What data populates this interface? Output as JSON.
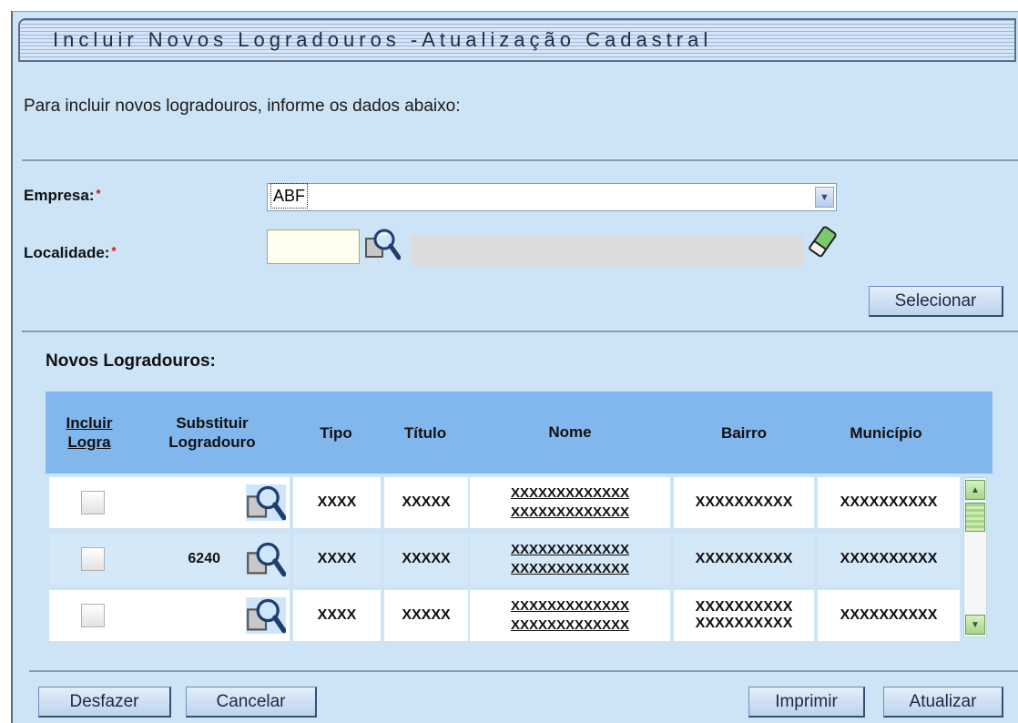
{
  "header": {
    "title": "Incluir Novos Logradouros -Atualização Cadastral"
  },
  "intro_text": "Para incluir novos logradouros, informe os dados abaixo:",
  "form": {
    "empresa_label": "Empresa:",
    "empresa_value": "ABF",
    "localidade_label": "Localidade:",
    "required_marker": "*",
    "localidade_value": "",
    "localidade_description": ""
  },
  "buttons": {
    "selecionar": "Selecionar",
    "desfazer": "Desfazer",
    "cancelar": "Cancelar",
    "imprimir": "Imprimir",
    "atualizar": "Atualizar"
  },
  "section_label": "Novos Logradouros:",
  "table": {
    "headers": {
      "incluir_line1": "Incluir",
      "incluir_line2": "Logra",
      "substituir_line1": "Substituir",
      "substituir_line2": "Logradouro",
      "tipo": "Tipo",
      "titulo": "Título",
      "nome": "Nome",
      "bairro": "Bairro",
      "municipio": "Município"
    },
    "rows": [
      {
        "checked": false,
        "substituir": "",
        "tipo": "XXXX",
        "titulo": "XXXXX",
        "nome_line1": "XXXXXXXXXXXXX",
        "nome_line2": "XXXXXXXXXXXXX",
        "bairro_line1": "XXXXXXXXXX",
        "bairro_line2": "",
        "municipio": "XXXXXXXXXX"
      },
      {
        "checked": false,
        "substituir": "6240",
        "tipo": "XXXX",
        "titulo": "XXXXX",
        "nome_line1": "XXXXXXXXXXXXX",
        "nome_line2": "XXXXXXXXXXXXX",
        "bairro_line1": "XXXXXXXXXX",
        "bairro_line2": "",
        "municipio": "XXXXXXXXXX"
      },
      {
        "checked": false,
        "substituir": "",
        "tipo": "XXXX",
        "titulo": "XXXXX",
        "nome_line1": "XXXXXXXXXXXXX",
        "nome_line2": "XXXXXXXXXXXXX",
        "bairro_line1": "XXXXXXXXXX",
        "bairro_line2": "XXXXXXXXXX",
        "municipio": "XXXXXXXXXX"
      }
    ]
  },
  "icons": {
    "lookup": "magnifier-search-icon",
    "clear": "eraser-icon",
    "dropdown": "chevron-down-icon",
    "scroll_up": "scroll-up-arrow-icon",
    "scroll_down": "scroll-down-arrow-icon"
  },
  "colors": {
    "panel_background": "#cde3f6",
    "table_header": "#82b7ee",
    "alt_row": "#d5e8f8",
    "required": "#d01010"
  }
}
